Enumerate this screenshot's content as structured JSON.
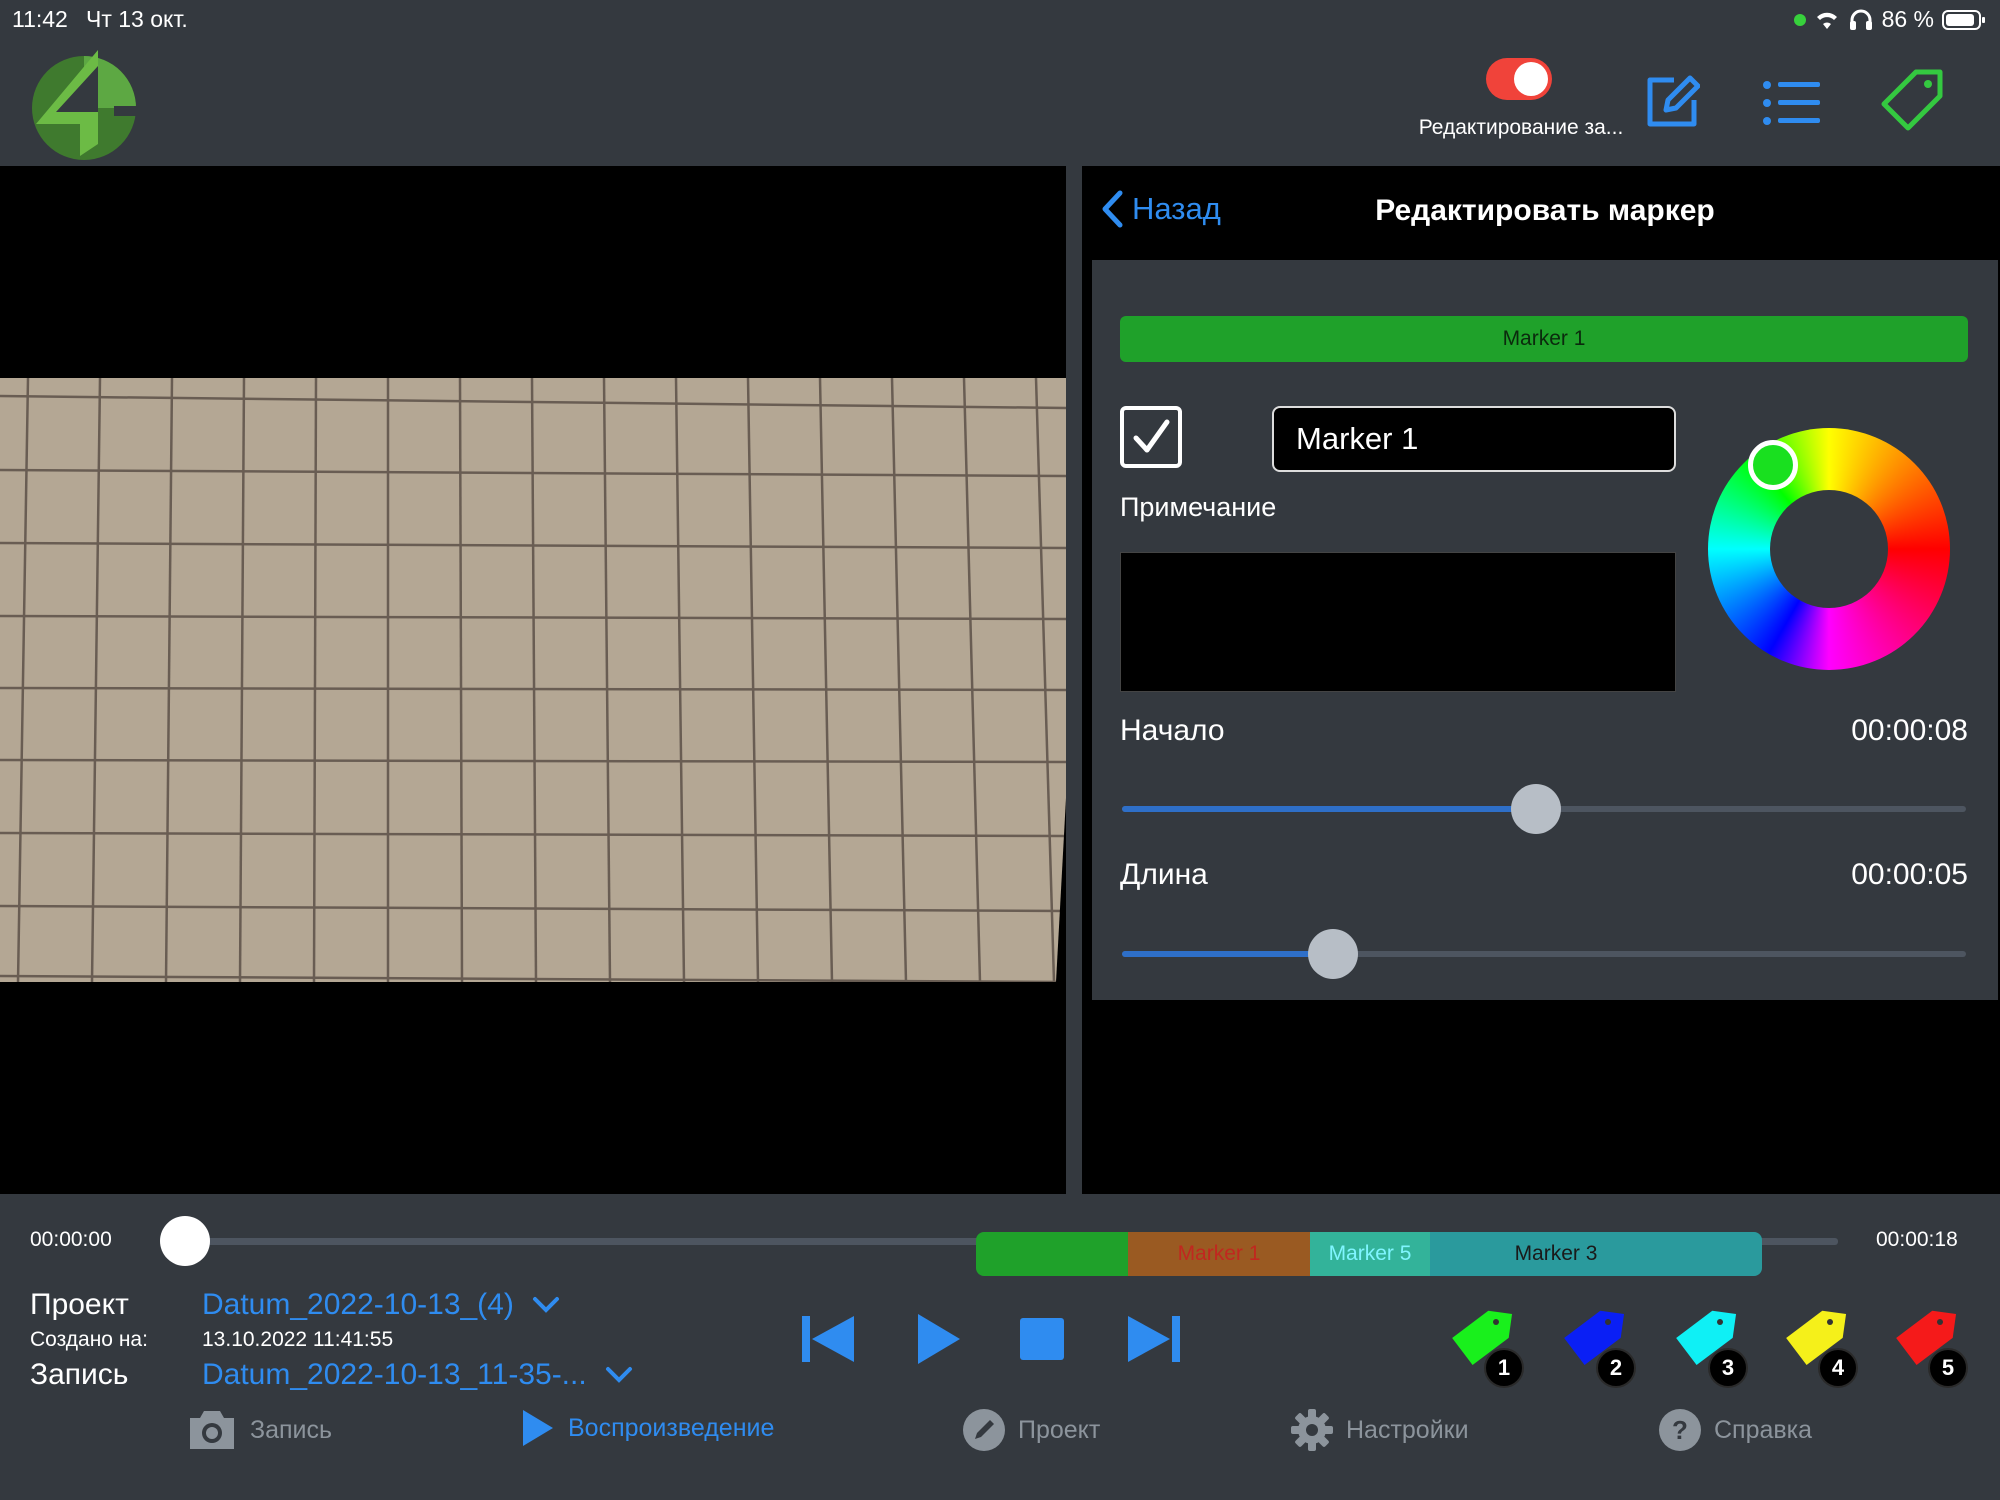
{
  "status_bar": {
    "time": "11:42",
    "date": "Чт 13 окт.",
    "battery": "86 %"
  },
  "header": {
    "toggle_label": "Редактирование за...",
    "toggle_on": true,
    "icons": [
      "logo-icon",
      "edit-icon",
      "list-icon",
      "tag-icon"
    ]
  },
  "edit_panel": {
    "back_label": "Назад",
    "title": "Редактировать маркер",
    "marker_bar_label": "Marker 1",
    "marker_color": "#1fa12a",
    "checkbox_checked": true,
    "name_value": "Marker 1",
    "note_label": "Примечание",
    "note_value": "",
    "start_label": "Начало",
    "start_value": "00:00:08",
    "start_fraction": 0.49,
    "length_label": "Длина",
    "length_value": "00:00:05",
    "length_fraction": 0.25
  },
  "timeline": {
    "start_time": "00:00:00",
    "end_time": "00:00:18",
    "position_fraction": 0.0,
    "segments": [
      {
        "label": "Marker 1",
        "color": "#1fa12a",
        "text_color": "#c1271f"
      },
      {
        "label": "Marker 5",
        "color": "#2abfa5",
        "text_color": "#7ff5ff"
      },
      {
        "label": "Marker 3",
        "color": "#2a9a9d",
        "text_color": "#1a1a1a"
      }
    ]
  },
  "project_info": {
    "project_label": "Проект",
    "project_value": "Datum_2022-10-13_(4)",
    "created_label": "Создано на:",
    "created_value": "13.10.2022 11:41:55",
    "record_label": "Запись",
    "record_value": "Datum_2022-10-13_11-35-..."
  },
  "marker_tags": [
    {
      "num": "1",
      "color": "#19f01c"
    },
    {
      "num": "2",
      "color": "#0a1ff5"
    },
    {
      "num": "3",
      "color": "#0ff0f5"
    },
    {
      "num": "4",
      "color": "#f5f01a"
    },
    {
      "num": "5",
      "color": "#f51a1a"
    }
  ],
  "bottom_nav": [
    {
      "label": "Запись",
      "icon": "camera-icon",
      "active": false
    },
    {
      "label": "Воспроизведение",
      "icon": "play-icon",
      "active": true
    },
    {
      "label": "Проект",
      "icon": "pencil-icon",
      "active": false
    },
    {
      "label": "Настройки",
      "icon": "gear-icon",
      "active": false
    },
    {
      "label": "Справка",
      "icon": "help-icon",
      "active": false
    }
  ]
}
